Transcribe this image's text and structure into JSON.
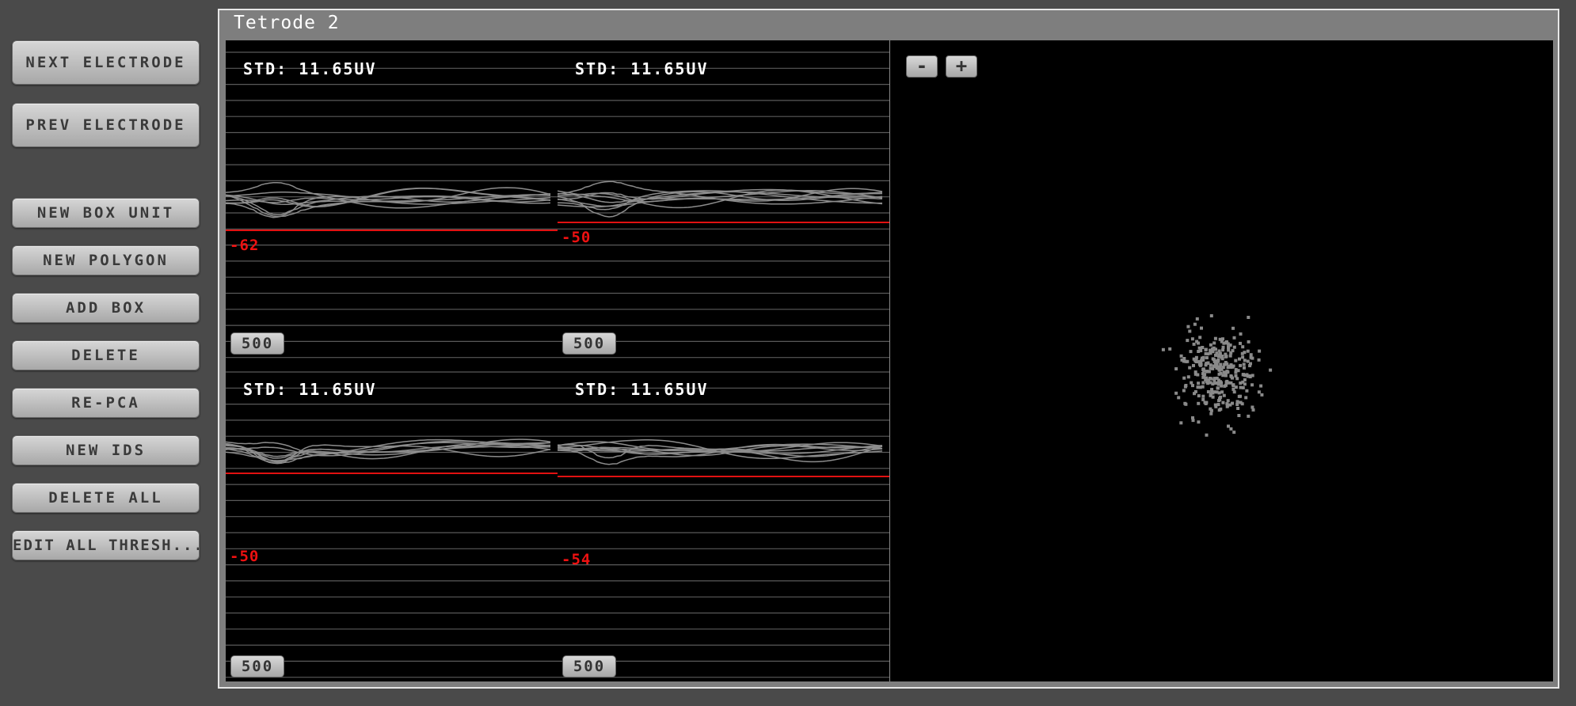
{
  "sidebar": {
    "buttons": [
      {
        "id": "next-electrode",
        "label": "NEXT ELECTRODE"
      },
      {
        "id": "prev-electrode",
        "label": "PREV ELECTRODE"
      },
      {
        "id": "new-box-unit",
        "label": "NEW BOX UNIT"
      },
      {
        "id": "new-polygon",
        "label": "NEW POLYGON"
      },
      {
        "id": "add-box",
        "label": "ADD BOX"
      },
      {
        "id": "delete",
        "label": "DELETE"
      },
      {
        "id": "re-pca",
        "label": "RE-PCA"
      },
      {
        "id": "new-ids",
        "label": "NEW IDS"
      },
      {
        "id": "delete-all",
        "label": "DELETE ALL"
      },
      {
        "id": "edit-all-thresh",
        "label": "EDIT ALL THRESH..."
      }
    ]
  },
  "editor": {
    "title": "Tetrode 2",
    "channels": [
      {
        "std": "STD: 11.65UV",
        "threshold": "-62",
        "threshold_value": -62,
        "range": "500"
      },
      {
        "std": "STD: 11.65UV",
        "threshold": "-50",
        "threshold_value": -50,
        "range": "500"
      },
      {
        "std": "STD: 11.65UV",
        "threshold": "-50",
        "threshold_value": -50,
        "range": "500"
      },
      {
        "std": "STD: 11.65UV",
        "threshold": "-54",
        "threshold_value": -54,
        "range": "500"
      }
    ],
    "pca": {
      "zoom_out_label": "-",
      "zoom_in_label": "+"
    }
  },
  "colors": {
    "background": "#4a4a4a",
    "panel_bg": "#000000",
    "grid_line": "#5a5a5a",
    "waveform": "#8c8c8c",
    "threshold": "#e11111",
    "pca_point": "#8a8a8a"
  }
}
